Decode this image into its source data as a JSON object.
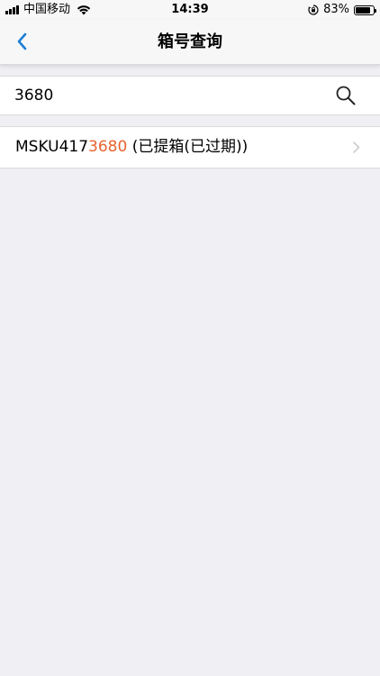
{
  "status_bar": {
    "carrier": "中国移动",
    "time": "14:39",
    "battery_percent": "83%",
    "battery_level": 0.83,
    "icons": [
      "signal-icon",
      "wifi-icon",
      "orientation-lock-icon",
      "battery-icon"
    ]
  },
  "nav": {
    "back_icon": "chevron-left-icon",
    "title": "箱号查询"
  },
  "search": {
    "value": "3680",
    "placeholder": "",
    "icon": "search-icon"
  },
  "results": [
    {
      "prefix": "MSKU417",
      "match": "3680",
      "status": " (已提箱(已过期))"
    }
  ],
  "colors": {
    "accent": "#1c7ed6",
    "highlight": "#e8642e",
    "background": "#efeff4"
  }
}
